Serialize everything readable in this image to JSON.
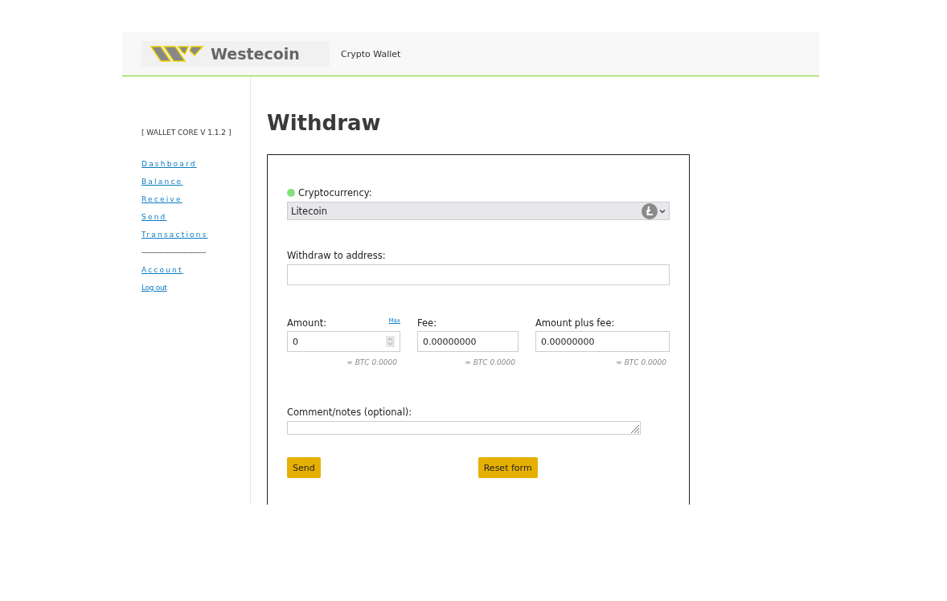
{
  "header": {
    "logo_text": "Westecoin",
    "title": "Crypto Wallet"
  },
  "sidebar": {
    "version": "[ WALLET CORE V 1.1.2 ]",
    "items": [
      {
        "label": "Dashboard",
        "kind": "spaced"
      },
      {
        "label": "Balance",
        "kind": "spaced"
      },
      {
        "label": "Receive",
        "kind": "spaced"
      },
      {
        "label": "Send",
        "kind": "spaced"
      },
      {
        "label": "Transactions",
        "kind": "spaced"
      },
      {
        "label": "-----------------------------",
        "kind": "separator"
      },
      {
        "label": "Account",
        "kind": "spaced"
      },
      {
        "label": "Log out",
        "kind": "plain"
      }
    ]
  },
  "page_title": "Withdraw",
  "form": {
    "currency": {
      "label": "Cryptocurrency:",
      "value": "Litecoin"
    },
    "address": {
      "label": "Withdraw to address:"
    },
    "amounts": [
      {
        "label": "Amount:",
        "value": "0",
        "kind": "number",
        "link": "Max",
        "estimate": "≈ BTC 0.0000"
      },
      {
        "label": "Fee:",
        "value": "0.00000000",
        "kind": "text",
        "estimate": "≈ BTC 0.0000"
      },
      {
        "label": "Amount plus fee:",
        "value": "0.00000000",
        "kind": "text",
        "estimate": "≈ BTC 0.0000"
      }
    ],
    "comment": {
      "label": "Comment/notes (optional):"
    },
    "buttons": [
      "Send",
      "Reset form"
    ]
  }
}
